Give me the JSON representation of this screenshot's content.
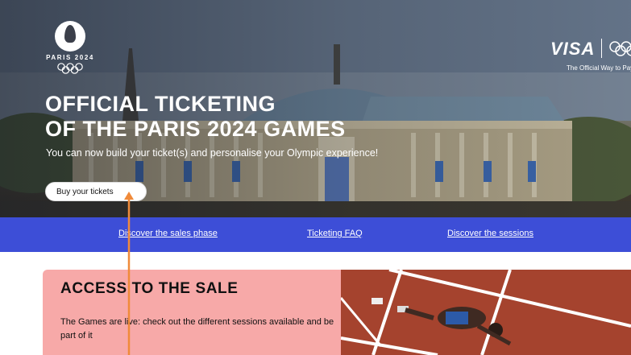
{
  "hero": {
    "logo": {
      "text": "PARIS 2024",
      "icon": "paris-2024-flame-icon"
    },
    "sponsor": {
      "brand": "VISA",
      "tagline": "The Official Way to Pay"
    },
    "headline_line1": "OFFICIAL TICKETING",
    "headline_line2": "OF THE PARIS 2024 GAMES",
    "subline": "You can now build your ticket(s) and personalise your Olympic experience!",
    "buy_button": "Buy your tickets"
  },
  "nav": {
    "links": [
      {
        "label": "Discover the sales phase"
      },
      {
        "label": "Ticketing FAQ"
      },
      {
        "label": "Discover the sessions"
      }
    ]
  },
  "access": {
    "title": "ACCESS TO THE SALE",
    "text": "The Games are live: check out the different sessions available and be part of it"
  },
  "colors": {
    "nav_bar": "#3d4ed7",
    "access_card": "#f7a9a8",
    "track": "#a5432e",
    "annotation_arrow": "#f08a3a"
  }
}
